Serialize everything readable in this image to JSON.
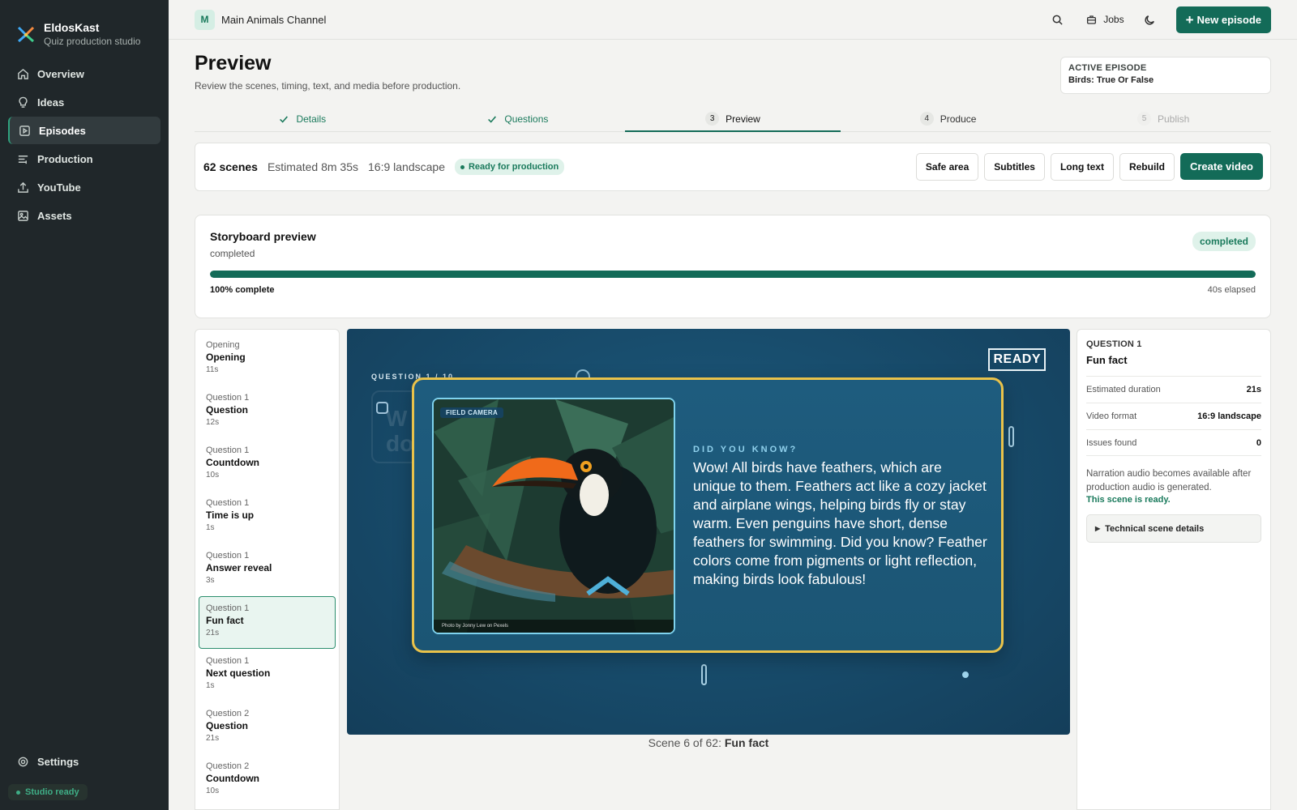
{
  "app": {
    "name": "EldosKast",
    "tagline": "Quiz production studio"
  },
  "sidebar": {
    "items": [
      {
        "label": "Overview",
        "icon": "home-icon"
      },
      {
        "label": "Ideas",
        "icon": "lightbulb-icon"
      },
      {
        "label": "Episodes",
        "icon": "play-square-icon",
        "active": true
      },
      {
        "label": "Production",
        "icon": "sliders-icon"
      },
      {
        "label": "YouTube",
        "icon": "upload-icon"
      },
      {
        "label": "Assets",
        "icon": "image-icon"
      }
    ],
    "settings_label": "Settings",
    "status_label": "Studio ready"
  },
  "topbar": {
    "channel_initial": "M",
    "channel_name": "Main Animals Channel",
    "jobs_label": "Jobs",
    "new_episode_label": "New episode"
  },
  "header": {
    "title": "Preview",
    "subtitle": "Review the scenes, timing, text, and media before production.",
    "active_episode_label": "ACTIVE EPISODE",
    "active_episode_value": "Birds: True Or False"
  },
  "steps": [
    {
      "num": "",
      "label": "Details",
      "state": "done"
    },
    {
      "num": "",
      "label": "Questions",
      "state": "done"
    },
    {
      "num": "3",
      "label": "Preview",
      "state": "current"
    },
    {
      "num": "4",
      "label": "Produce",
      "state": "future"
    },
    {
      "num": "5",
      "label": "Publish",
      "state": "disabled"
    }
  ],
  "toolbar": {
    "scene_count": "62 scenes",
    "estimated": "Estimated 8m 35s",
    "format": "16:9 landscape",
    "status_badge": "Ready for production",
    "buttons": [
      "Safe area",
      "Subtitles",
      "Long text",
      "Rebuild"
    ],
    "create_label": "Create video"
  },
  "storyboard": {
    "title": "Storyboard preview",
    "status": "completed",
    "badge": "completed",
    "progress": 1.0,
    "percent_label": "100% complete",
    "elapsed": "40s elapsed"
  },
  "scenes": [
    {
      "group": "Opening",
      "name": "Opening",
      "duration": "11s"
    },
    {
      "group": "Question 1",
      "name": "Question",
      "duration": "12s"
    },
    {
      "group": "Question 1",
      "name": "Countdown",
      "duration": "10s"
    },
    {
      "group": "Question 1",
      "name": "Time is up",
      "duration": "1s"
    },
    {
      "group": "Question 1",
      "name": "Answer reveal",
      "duration": "3s"
    },
    {
      "group": "Question 1",
      "name": "Fun fact",
      "duration": "21s",
      "active": true
    },
    {
      "group": "Question 1",
      "name": "Next question",
      "duration": "1s"
    },
    {
      "group": "Question 2",
      "name": "Question",
      "duration": "21s"
    },
    {
      "group": "Question 2",
      "name": "Countdown",
      "duration": "10s"
    }
  ],
  "preview": {
    "ready_tag": "READY",
    "question_label": "QUESTION 1 / 10",
    "photo_tag": "FIELD CAMERA",
    "photo_credit": "Photo by Jonny Lew on Pexels",
    "did_you_know": "DID YOU KNOW?",
    "fact_text": "Wow! All birds have feathers, which are unique to them. Feathers act like a cozy jacket and airplane wings, helping birds fly or stay warm. Even penguins have short, dense feathers for swimming. Did you know? Feather colors come from pigments or light reflection, making birds look fabulous!",
    "caption_prefix": "Scene 6 of 62:",
    "caption_scene": "Fun fact"
  },
  "details": {
    "label": "QUESTION 1",
    "title": "Fun fact",
    "rows": [
      {
        "key": "Estimated duration",
        "value": "21s"
      },
      {
        "key": "Video format",
        "value": "16:9 landscape"
      },
      {
        "key": "Issues found",
        "value": "0"
      }
    ],
    "note": "Narration audio becomes available after production audio is generated.",
    "note_ready": "This scene is ready.",
    "technical_label": "Technical scene details"
  },
  "colors": {
    "accent": "#136b58",
    "sidebar_bg": "#20272a",
    "card_border": "#e9c24a",
    "stage_bg": "#184d6d"
  }
}
